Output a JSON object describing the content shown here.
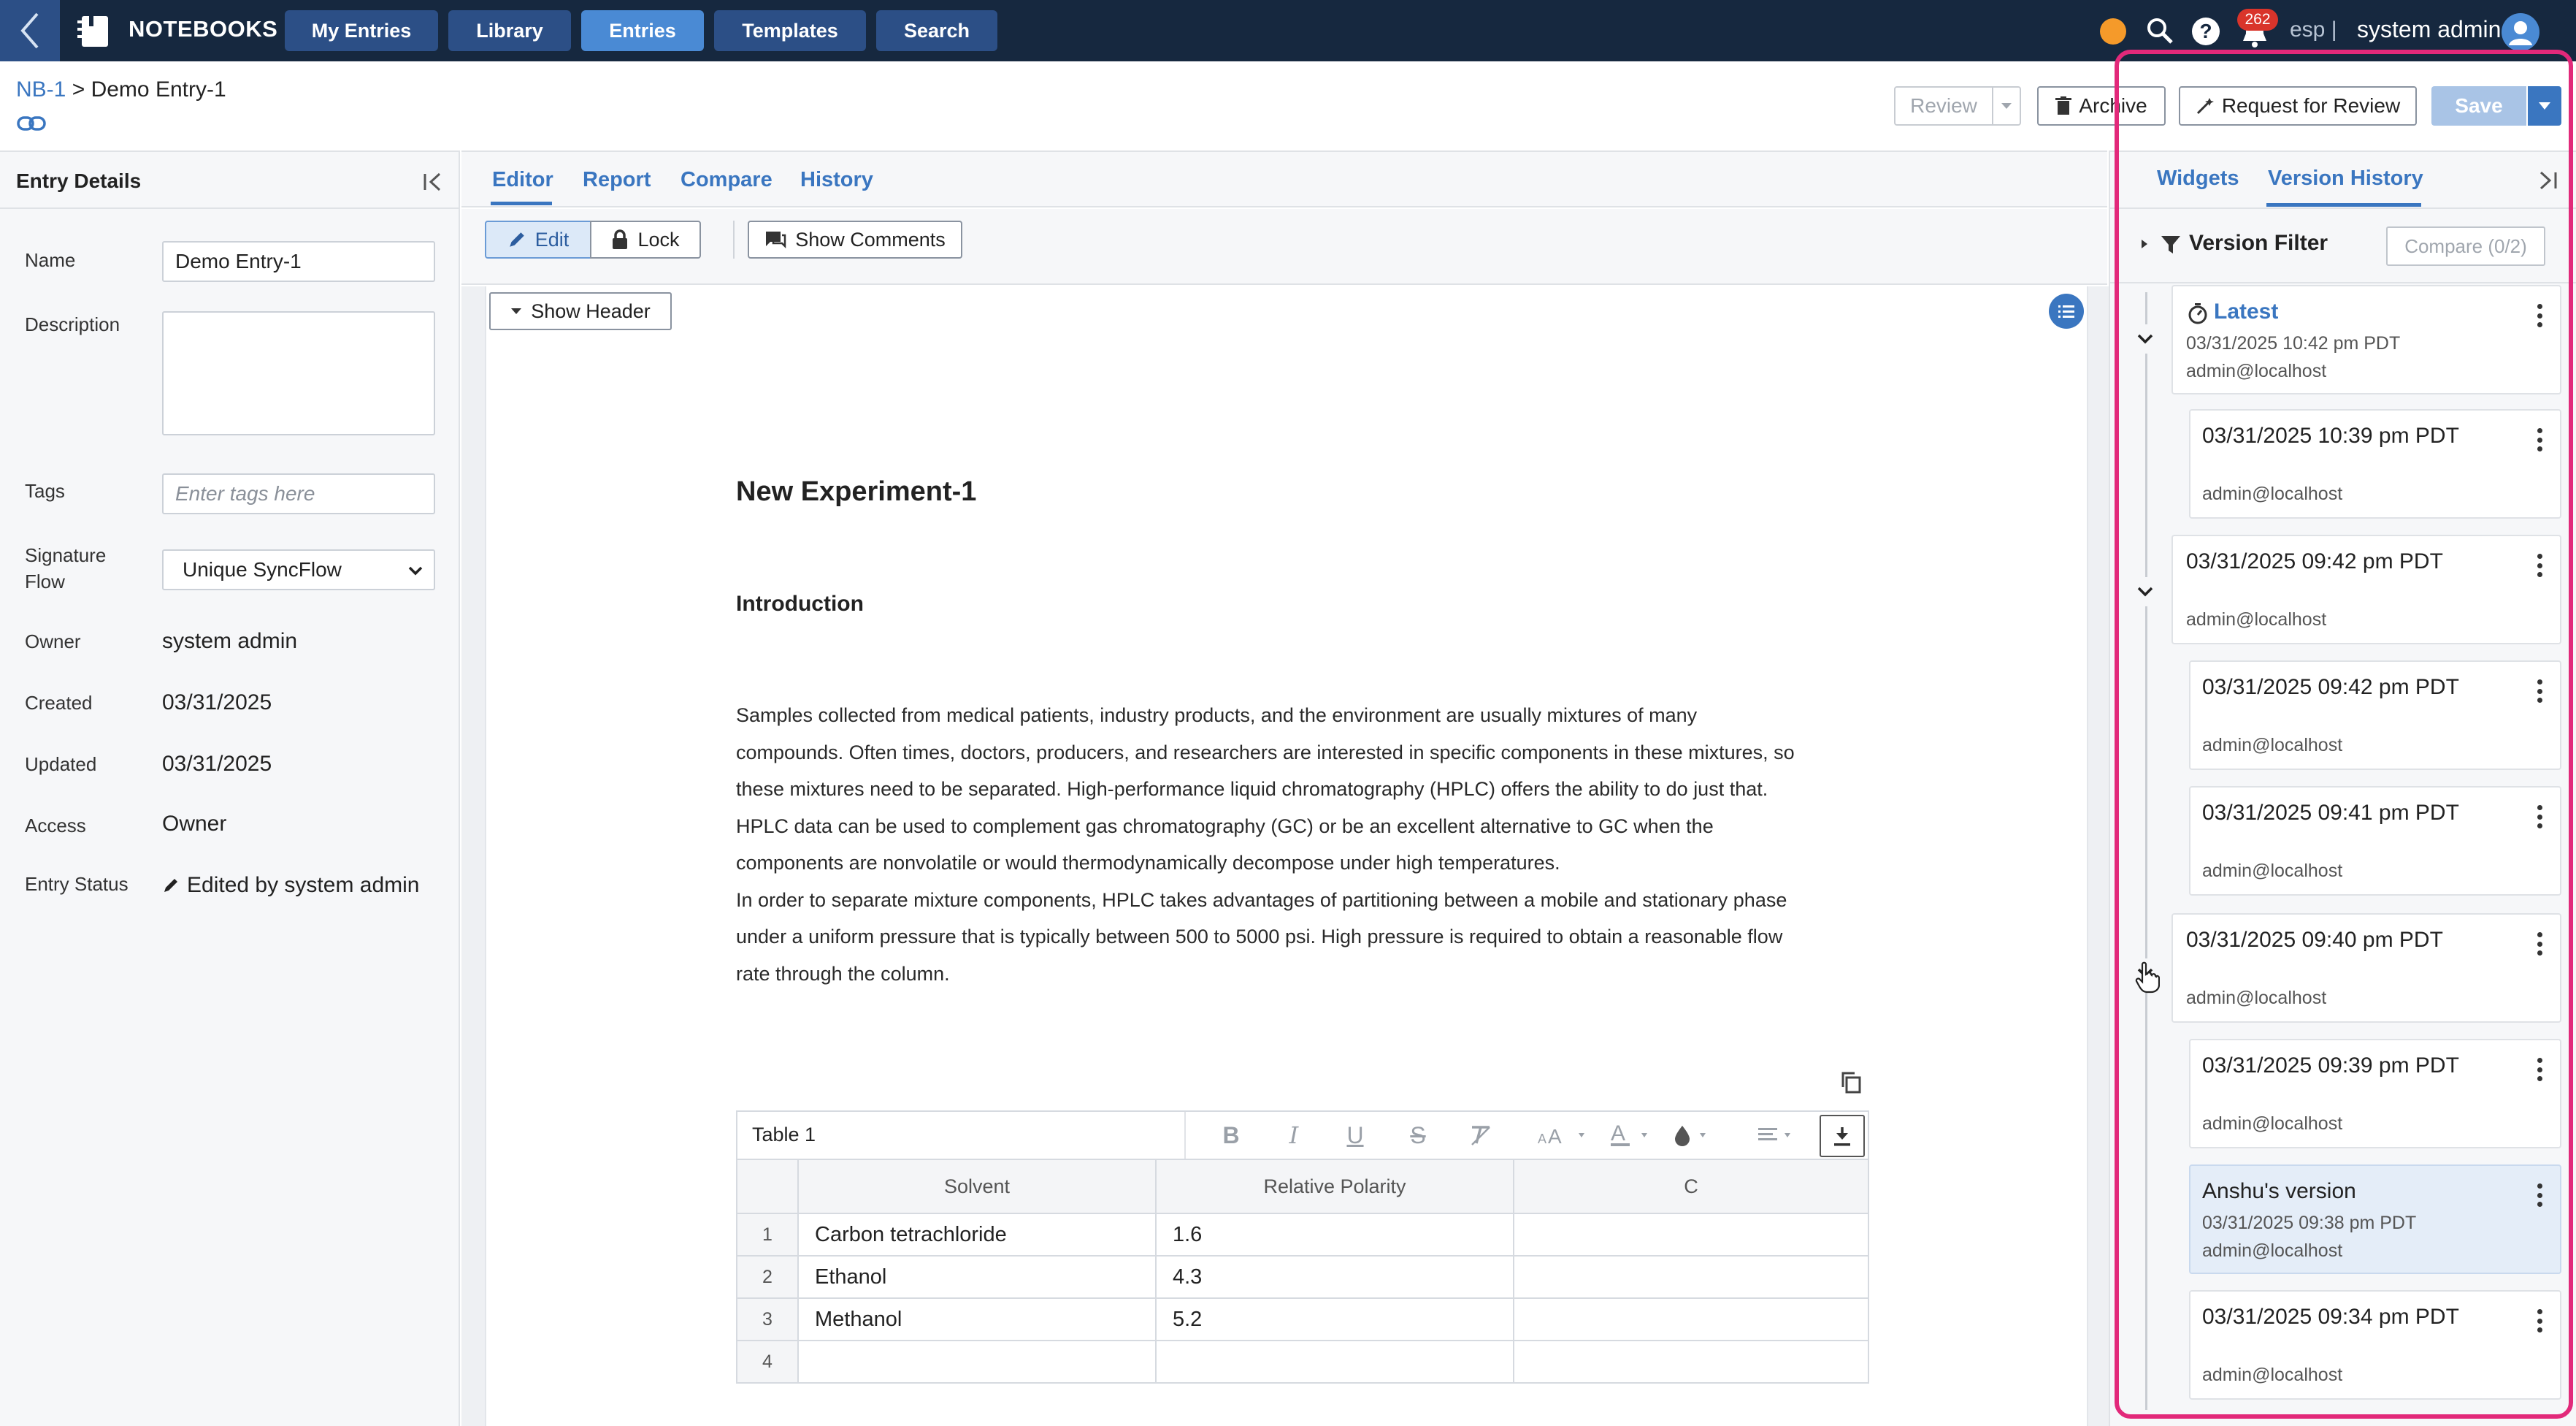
{
  "topbar": {
    "app_name": "NOTEBOOKS",
    "nav": [
      "My Entries",
      "Library",
      "Entries",
      "Templates",
      "Search"
    ],
    "active_nav": "Entries",
    "notification_count": "262",
    "language": "esp |",
    "user_name": "system admin",
    "status_color": "#f59a2a"
  },
  "header": {
    "breadcrumb_root": "NB-1",
    "breadcrumb_sep": ">",
    "breadcrumb_current": "Demo Entry-1",
    "review_label": "Review",
    "archive_label": "Archive",
    "request_review_label": "Request for Review",
    "save_label": "Save"
  },
  "left_panel": {
    "title": "Entry Details",
    "name_label": "Name",
    "name_value": "Demo Entry-1",
    "description_label": "Description",
    "description_value": "",
    "tags_label": "Tags",
    "tags_placeholder": "Enter tags here",
    "signature_label_1": "Signature",
    "signature_label_2": "Flow",
    "signature_value": "Unique SyncFlow",
    "owner_label": "Owner",
    "owner_value": "system admin",
    "created_label": "Created",
    "created_value": "03/31/2025",
    "updated_label": "Updated",
    "updated_value": "03/31/2025",
    "access_label": "Access",
    "access_value": "Owner",
    "status_label": "Entry Status",
    "status_value": "Edited by system admin"
  },
  "center": {
    "tabs": [
      "Editor",
      "Report",
      "Compare",
      "History"
    ],
    "active_tab": "Editor",
    "edit_label": "Edit",
    "lock_label": "Lock",
    "show_comments_label": "Show Comments",
    "show_header_label": "Show Header",
    "doc_title": "New Experiment-1",
    "section_heading": "Introduction",
    "paragraph_lines": [
      "Samples collected from medical patients, industry products, and the environment are usually mixtures of many",
      "compounds. Often times, doctors, producers, and researchers are interested in specific components in these mixtures, so",
      "these mixtures need to be separated. High-performance liquid chromatography (HPLC) offers the ability to do just that.",
      "HPLC data can be used to complement gas chromatography (GC) or be an excellent alternative to GC when the",
      "components are nonvolatile or would thermodynamically decompose under high temperatures.",
      "In order to separate mixture components, HPLC takes advantages of partitioning between a mobile and stationary phase",
      "under a uniform pressure that is typically between 500 to 5000 psi. High pressure is required to obtain a reasonable flow",
      "rate through the column."
    ],
    "table": {
      "name": "Table 1",
      "headers": [
        "",
        "Solvent",
        "Relative Polarity",
        "C"
      ],
      "rows": [
        [
          "1",
          "Carbon tetrachloride",
          "1.6",
          ""
        ],
        [
          "2",
          "Ethanol",
          "4.3",
          ""
        ],
        [
          "3",
          "Methanol",
          "5.2",
          ""
        ],
        [
          "4",
          "",
          "",
          ""
        ]
      ]
    }
  },
  "right_panel": {
    "tabs": [
      "Widgets",
      "Version History"
    ],
    "active_tab": "Version History",
    "filter_label": "Version Filter",
    "compare_label": "Compare (0/2)",
    "versions": [
      {
        "title": "Latest",
        "date": "03/31/2025 10:42 pm PDT",
        "user": "admin@localhost"
      },
      {
        "title": "03/31/2025 10:39 pm PDT",
        "user": "admin@localhost"
      },
      {
        "title": "03/31/2025 09:42 pm PDT",
        "user": "admin@localhost"
      },
      {
        "title": "03/31/2025 09:42 pm PDT",
        "user": "admin@localhost"
      },
      {
        "title": "03/31/2025 09:41 pm PDT",
        "user": "admin@localhost"
      },
      {
        "title": "03/31/2025 09:40 pm PDT",
        "user": "admin@localhost"
      },
      {
        "title": "03/31/2025 09:39 pm PDT",
        "user": "admin@localhost"
      },
      {
        "title": "Anshu's version",
        "date": "03/31/2025 09:38 pm PDT",
        "user": "admin@localhost"
      },
      {
        "title": "03/31/2025 09:34 pm PDT",
        "user": "admin@localhost"
      }
    ],
    "highlight_color": "#e2297a"
  }
}
